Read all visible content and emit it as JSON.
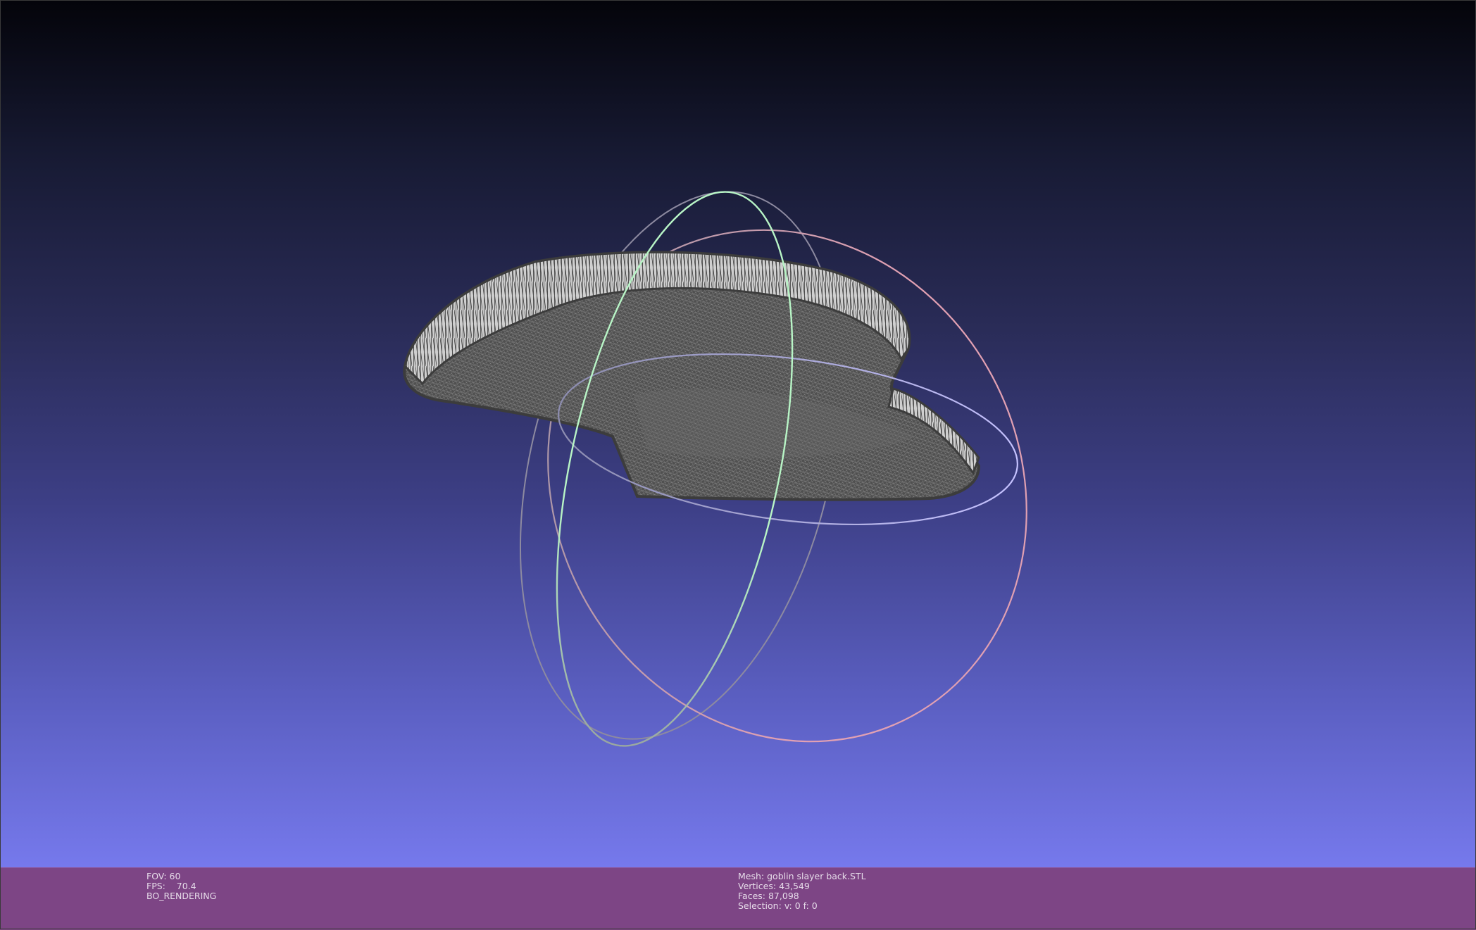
{
  "viewer": {
    "background_top": "#04040a",
    "background_bottom": "#7679ec",
    "status_bar_color": "#7d4585"
  },
  "status": {
    "fov_label": "FOV:",
    "fov_value": "60",
    "fps_label": "FPS:",
    "fps_value": "70.4",
    "render_mode": "BO_RENDERING",
    "mesh_label": "Mesh:",
    "mesh_name": "goblin slayer back.STL",
    "vertices_label": "Vertices:",
    "vertices_value": "43,549",
    "faces_label": "Faces:",
    "faces_value": "87,098",
    "selection_label": "Selection:",
    "selection_value": "v: 0 f: 0"
  },
  "trackball": {
    "ring_colors": [
      "#b7f0c0",
      "#c09aa8",
      "#b7b3ff"
    ]
  },
  "mesh": {
    "surface_color": "#555555",
    "wire_color": "#d8d8d8"
  }
}
